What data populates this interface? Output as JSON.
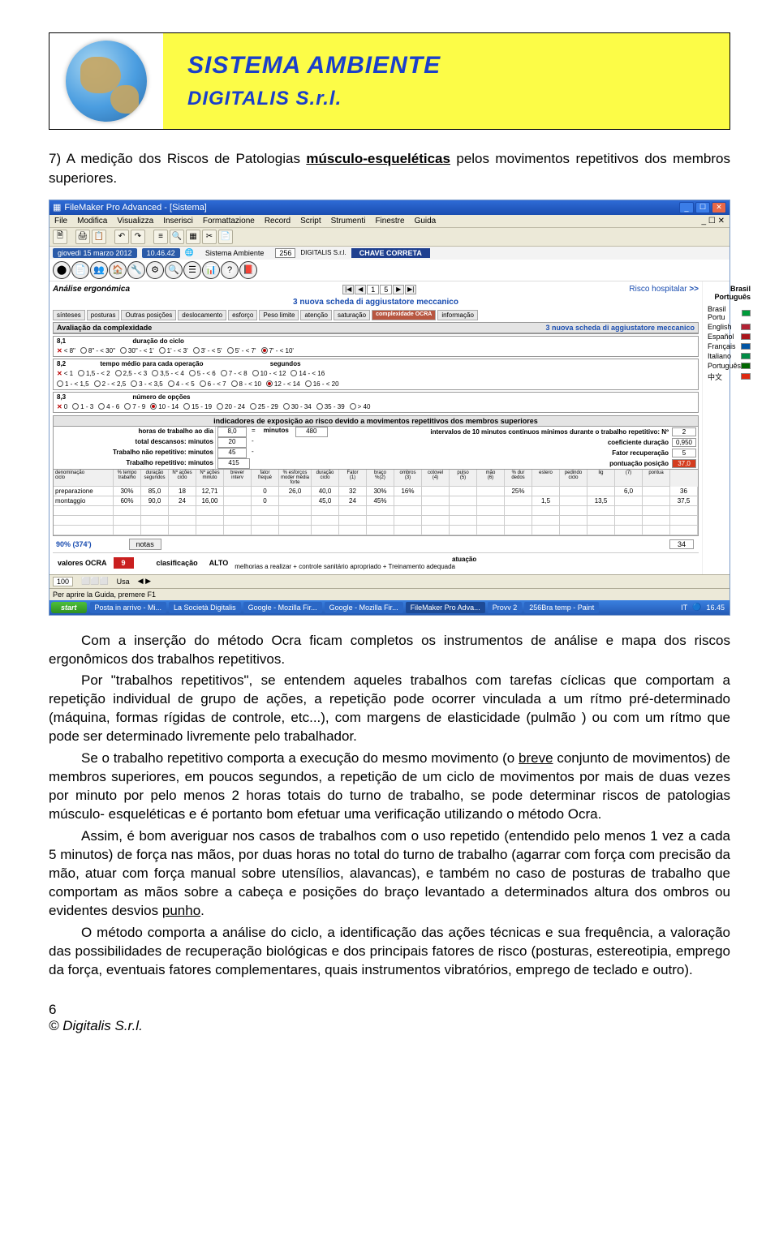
{
  "banner": {
    "title": "SISTEMA AMBIENTE",
    "subtitle": "DIGITALIS S.r.l."
  },
  "heading": {
    "prefix": "7) A medição dos Riscos de Patologias ",
    "bold": "músculo-esqueléticas",
    "suffix": " pelos movimentos repetitivos dos membros superiores."
  },
  "screenshot": {
    "window_title": "FileMaker Pro Advanced - [Sistema]",
    "menubar": [
      "File",
      "Modifica",
      "Visualizza",
      "Inserisci",
      "Formattazione",
      "Record",
      "Script",
      "Strumenti",
      "Finestre",
      "Guida"
    ],
    "date": "giovedì 15 marzo 2012",
    "time": "10.46.42",
    "sistema_label": "Sistema Ambiente",
    "num": "256",
    "digitalis": "DIGITALIS S.r.l.",
    "chave": "CHAVE CORRETA",
    "brasil_right": "Brasil Português",
    "languages": [
      "Brasil Portu",
      "English",
      "Español",
      "Français",
      "Italiano",
      "Português",
      "中文"
    ],
    "breadcrumb_section": "Análise ergonómica",
    "nav_nums": [
      "1",
      "5"
    ],
    "risco_label": "Risco hospitalar",
    "risco_arrow": ">>",
    "scheda_title": "3 nuova scheda di aggiustatore meccanico",
    "sub_tabs": [
      "sínteses",
      "posturas",
      "Outras posições",
      "deslocamento",
      "esforço",
      "Peso limite",
      "atenção",
      "saturação"
    ],
    "sub_tab_active": "complexidade OCRA",
    "sub_tab_last": "informação",
    "avaliacao_header": "Avaliação da complexidade",
    "avaliacao_header_right": "3 nuova scheda di aggiustatore meccanico",
    "s81": {
      "label": "8,1",
      "title": "duração do ciclo",
      "opts": [
        "< 8\"",
        "8\" - < 30\"",
        "30\" - < 1'",
        "1' - < 3'",
        "3' - < 5'",
        "5' - < 7'",
        "7' - < 10'"
      ],
      "selected_idx": 6
    },
    "s82": {
      "label": "8,2",
      "title": "tempo médio para cada operação",
      "unit": "segundos",
      "opts_row1": [
        "< 1",
        "1,5 - < 2",
        "2,5 - < 3",
        "3,5 - < 4",
        "5 - < 6",
        "7 - < 8",
        "10 - < 12",
        "14 - < 16"
      ],
      "opts_row2": [
        "1 - < 1,5",
        "2 - < 2,5",
        "3 - < 3,5",
        "4 - < 5",
        "6 - < 7",
        "8 - < 10",
        "12 - < 14",
        "16 - < 20"
      ],
      "selected_r1_idx": -1,
      "selected_r2_idx": 6
    },
    "s83": {
      "label": "8,3",
      "title": "número de opções",
      "opts": [
        "0",
        "1 - 3",
        "4 - 6",
        "7 - 9",
        "10 - 14",
        "15 - 19",
        "20 - 24",
        "25 - 29",
        "30 - 34",
        "35 - 39",
        "> 40"
      ],
      "selected_idx": 4
    },
    "indicators_header": "indicadores de exposição ao risco devido a movimentos repetitivos dos membros superiores",
    "ind": {
      "r1_left": "horas de trabalho ao dia",
      "r1_val1": "8,0",
      "r1_eq": "=",
      "r1_unit": "minutos",
      "r1_val2": "480",
      "r1_right_lbl": "intervalos de 10 minutos contínuos mínimos durante o trabalho repetitivo: Nº",
      "r1_right_val": "2",
      "r2_left": "total descansos: minutos",
      "r2_val": "20",
      "r2_dash": "-",
      "r2_right_lbl": "coeficiente duração",
      "r2_right_val": "0,950",
      "r3_left": "Trabalho não repetitivo: minutos",
      "r3_val": "45",
      "r3_dash": "-",
      "r3_right_lbl": "Fator recuperação",
      "r3_right_val": "5",
      "r4_left": "Trabalho repetitivo: minutos",
      "r4_val": "415",
      "r4_right_lbl": "pontuação posição",
      "r4_right_val": "37,0"
    },
    "cycles_hdrs": [
      "denominação ciclo",
      "% do tempo de trabalho",
      "duração segundos",
      "Nº ações ciclo",
      "Nº ações minuto",
      "brever interv",
      "fator frequé",
      "% esforços",
      "duração do ciclo moder média forte",
      "Fator (1)",
      "braço %(2)",
      "ombros (3)",
      "cotovel (4)",
      "pulso (5)",
      "mão (6)",
      "% duração do ciclo dedos",
      "estero",
      "ciclo pedindo",
      "lig",
      "(7)",
      "esforço",
      "pontua"
    ],
    "cycle_rows": [
      {
        "label": "preparazione",
        "c": [
          "30%",
          "85,0",
          "18",
          "12,71",
          "",
          "0",
          "26,0",
          "40,0",
          "32",
          "30%",
          "16%",
          "",
          "",
          "",
          "25%",
          "",
          "",
          "",
          "6,0",
          "",
          "36"
        ]
      },
      {
        "label": "montaggio",
        "c": [
          "60%",
          "90,0",
          "24",
          "16,00",
          "",
          "0",
          "",
          "45,0",
          "24",
          "45%",
          "",
          "",
          "",
          "",
          "",
          "1,5",
          "",
          "13,5",
          "",
          "",
          "37,5"
        ]
      }
    ],
    "empty_rows": 3,
    "pct_label": "90% (374')",
    "notas": "notas",
    "notas_val": "34",
    "valores_label": "valores OCRA",
    "valores_num": "9",
    "class_label": "clasificação",
    "class_val": "ALTO",
    "atuacao_head": "atuação",
    "atuacao_text": "melhorias a realizar + controle sanitário apropriado + Treinamento adequada",
    "status_left": "100",
    "status_usa": "Usa",
    "helper": "Per aprire la Guida, premere F1",
    "taskbar": {
      "start": "start",
      "items": [
        "Posta in arrivo - Mi...",
        "La Società Digitalis",
        "Google - Mozilla Fir...",
        "Google - Mozilla Fir...",
        "FileMaker Pro Adva...",
        "Provv 2",
        "256Bra temp - Paint"
      ],
      "active_idx": 4,
      "tray_lang": "IT",
      "tray_time": "16.45"
    }
  },
  "paragraphs": {
    "p1_a": "Com a inserção do método Ocra ficam completos os instrumentos de análise e mapa dos riscos ergonômicos dos trabalhos repetitivos.",
    "p2_a": "Por \"trabalhos repetitivos\", se entendem aqueles trabalhos com tarefas cíclicas que comportam a repetição individual de grupo de ações, a repetição pode ocorrer vinculada a um rítmo pré-determinado (máquina, formas rígidas de controle, etc...), com margens de elasticidade (pulmão ) ou com um rítmo que pode ser  determinado livremente pelo trabalhador.",
    "p3_a": "Se o trabalho repetitivo comporta a execução do mesmo movimento (o ",
    "p3_u1": "breve",
    "p3_b": " conjunto de movimentos) de membros superiores, em poucos segundos, a repetição de um ciclo de movimentos por mais de duas vezes por minuto por pelo menos 2 horas totais do turno de trabalho, se pode determinar riscos de patologias músculo- esqueléticas e é portanto bom efetuar uma verificação utilizando o método Ocra.",
    "p4_a": "Assim, é bom averiguar nos casos de trabalhos com o uso repetido (entendido pelo menos 1 vez a cada 5 minutos) de força nas mãos, por duas horas no total do turno de trabalho (agarrar com força com  precisão da mão, atuar com força manual sobre utensílios, alavancas), e também no caso de posturas de trabalho que comportam as mãos sobre a cabeça e posições do braço levantado a determinados altura dos ombros ou evidentes desvios ",
    "p4_u1": "punho",
    "p4_b": ".",
    "p5_a": "O método comporta a análise do ciclo, a identificação das ações técnicas e sua frequência, a valoração das possibilidades de recuperação biológicas e dos principais fatores de risco (posturas, estereotipia, emprego da força, eventuais fatores complementares, quais instrumentos vibratórios, emprego de teclado e outro)."
  },
  "footer": {
    "page": "6",
    "copyright": "© Digitalis S.r.l."
  }
}
